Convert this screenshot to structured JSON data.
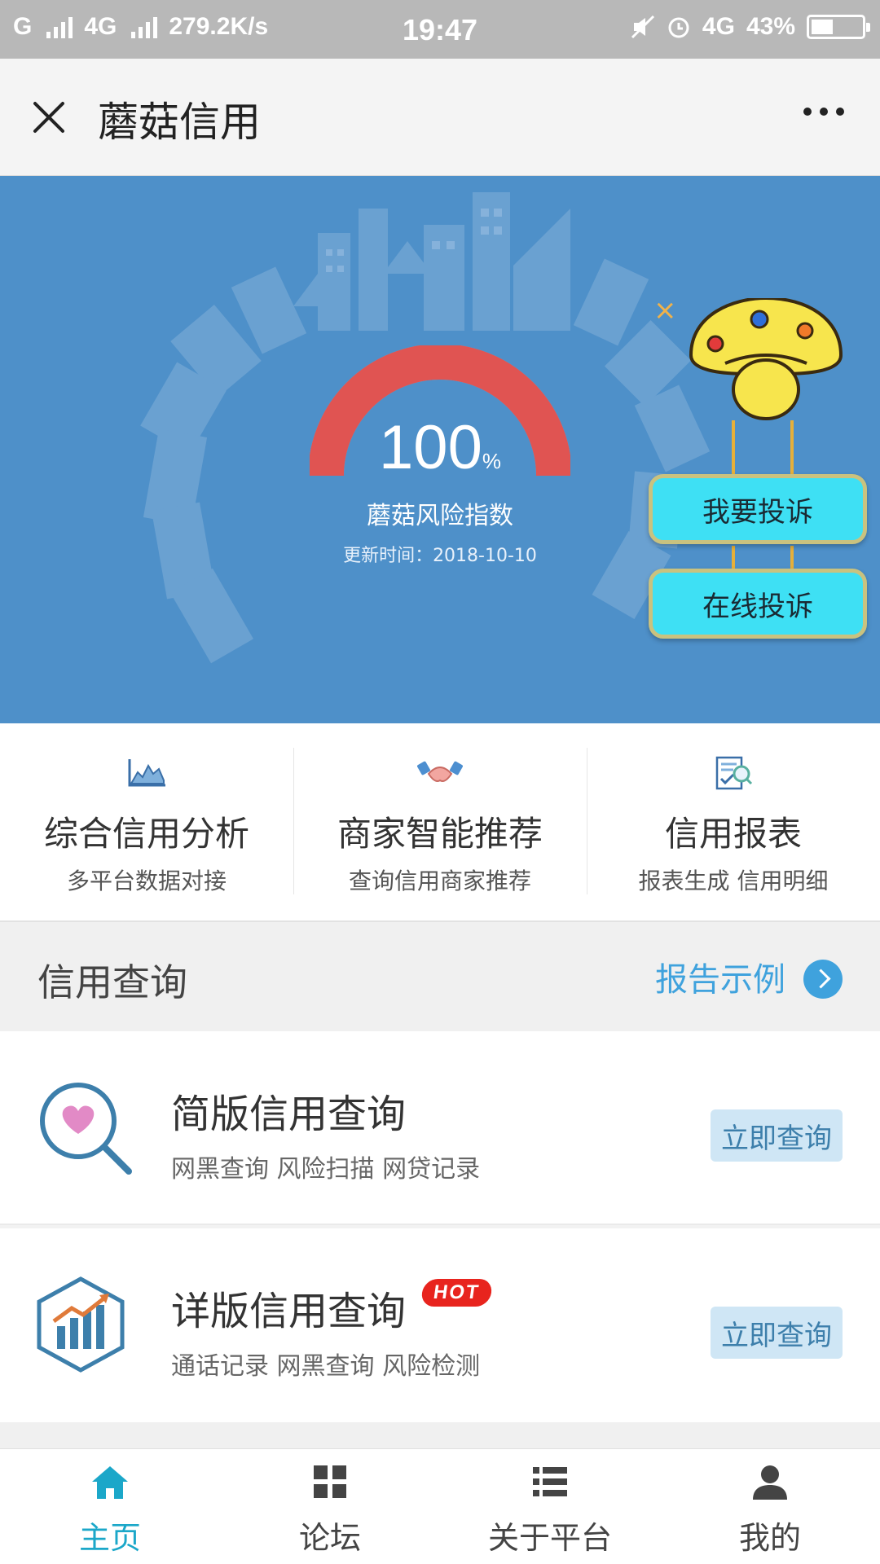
{
  "status_bar": {
    "carrier_1": "G",
    "carrier_2": "4G",
    "speed": "279.2K/s",
    "time": "19:47",
    "network": "4G",
    "battery": "43%",
    "battery_level": 0.43
  },
  "title_bar": {
    "title": "蘑菇信用",
    "close_icon": "close-icon",
    "more_icon": "more-icon"
  },
  "hero": {
    "score_value": "100",
    "score_unit": "%",
    "score_level": 1.0,
    "score_label": "蘑菇风险指数",
    "updated": "更新时间：2018-10-10",
    "gauge_color": "#e05452",
    "background_color": "#4e90c9",
    "mascot_close": "×",
    "complain_button": "我要投诉",
    "online_complain_button": "在线投诉"
  },
  "features": [
    {
      "title": "综合信用分析",
      "subtitle": "多平台数据对接",
      "icon": "chart-icon"
    },
    {
      "title": "商家智能推荐",
      "subtitle": "查询信用商家推荐",
      "icon": "handshake-icon"
    },
    {
      "title": "信用报表",
      "subtitle": "报表生成 信用明细",
      "icon": "report-icon"
    }
  ],
  "section": {
    "title": "信用查询",
    "report_link": "报告示例"
  },
  "queries": [
    {
      "title": "简版信用查询",
      "subtitle": "网黑查询 风险扫描 网贷记录",
      "button": "立即查询",
      "icon": "magnifier-heart-icon"
    },
    {
      "title": "详版信用查询",
      "subtitle": "通话记录 网黑查询 风险检测",
      "button": "立即查询",
      "badge": "HOT",
      "icon": "bar-chart-icon"
    }
  ],
  "bottom_nav": [
    {
      "label": "主页",
      "icon": "home-icon",
      "active": true
    },
    {
      "label": "论坛",
      "icon": "grid-icon",
      "active": false
    },
    {
      "label": "关于平台",
      "icon": "list-icon",
      "active": false
    },
    {
      "label": "我的",
      "icon": "user-icon",
      "active": false
    }
  ],
  "colors": {
    "accent": "#1ba7c9",
    "link": "#3fa2dd",
    "button_bg": "#cfe6f5",
    "hot": "#e8241e",
    "complain_bg": "#3ee0f4"
  }
}
